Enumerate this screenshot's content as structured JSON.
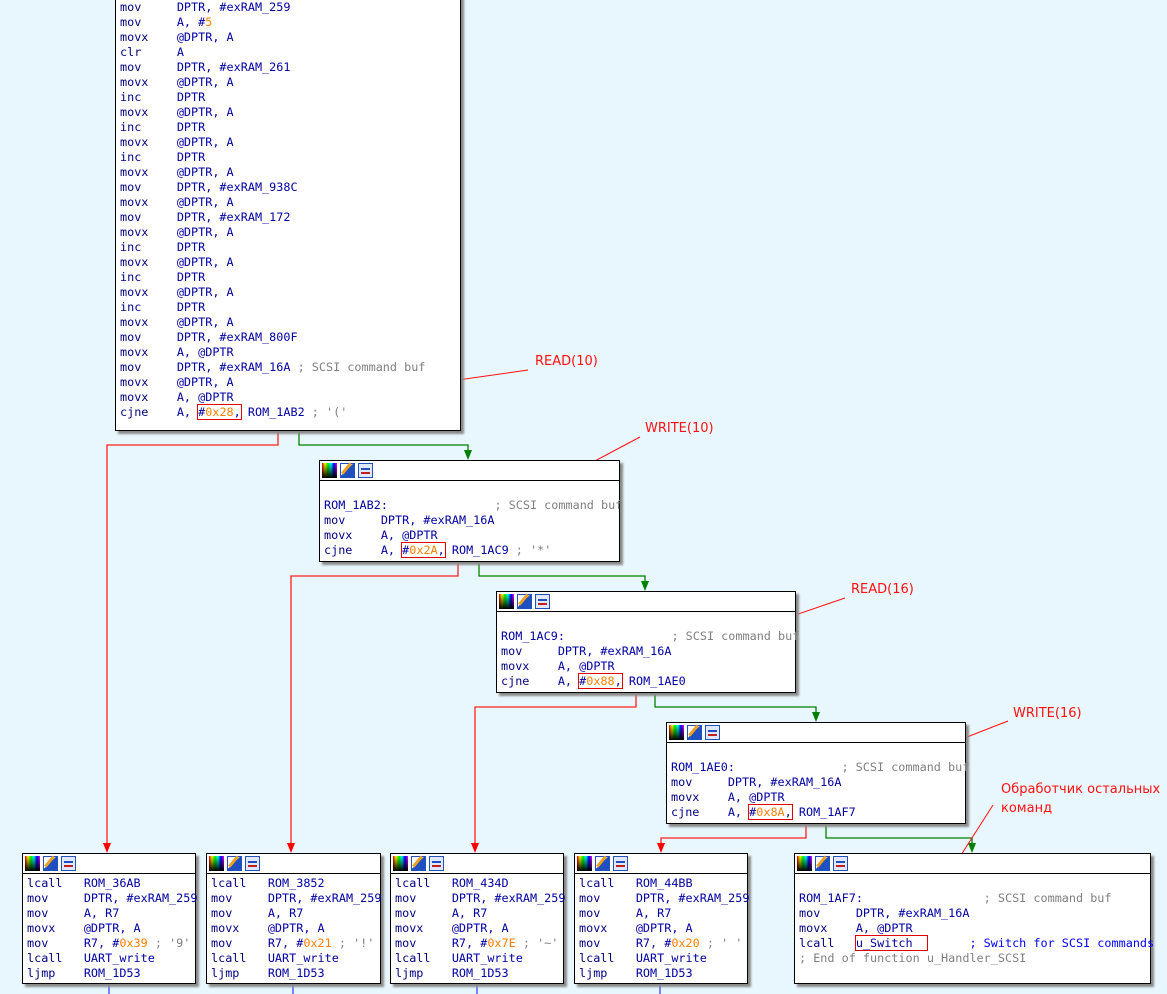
{
  "colors": {
    "background": "#e8f6fd",
    "true_edge": "#008000",
    "false_edge": "#ff0000",
    "flow_edge": "#4040ff",
    "annotation": "#ff1010",
    "number": "#ff8000"
  },
  "header_icons": [
    "color-palette-icon",
    "edit-pencil-icon",
    "graph-view-icon"
  ],
  "blocks": [
    {
      "id": "b0",
      "header": false,
      "lines": [
        {
          "mn": "mov",
          "seg": [
            {
              "t": "DPTR, #exRAM_259"
            }
          ]
        },
        {
          "mn": "mov",
          "seg": [
            {
              "t": "A, #"
            },
            {
              "t": "5",
              "c": "num"
            }
          ]
        },
        {
          "mn": "movx",
          "seg": [
            {
              "t": "@DPTR, A"
            }
          ]
        },
        {
          "mn": "clr",
          "seg": [
            {
              "t": "A"
            }
          ]
        },
        {
          "mn": "mov",
          "seg": [
            {
              "t": "DPTR, #exRAM_261"
            }
          ]
        },
        {
          "mn": "movx",
          "seg": [
            {
              "t": "@DPTR, A"
            }
          ]
        },
        {
          "mn": "inc",
          "seg": [
            {
              "t": "DPTR"
            }
          ]
        },
        {
          "mn": "movx",
          "seg": [
            {
              "t": "@DPTR, A"
            }
          ]
        },
        {
          "mn": "inc",
          "seg": [
            {
              "t": "DPTR"
            }
          ]
        },
        {
          "mn": "movx",
          "seg": [
            {
              "t": "@DPTR, A"
            }
          ]
        },
        {
          "mn": "inc",
          "seg": [
            {
              "t": "DPTR"
            }
          ]
        },
        {
          "mn": "movx",
          "seg": [
            {
              "t": "@DPTR, A"
            }
          ]
        },
        {
          "mn": "mov",
          "seg": [
            {
              "t": "DPTR, #exRAM_938C"
            }
          ]
        },
        {
          "mn": "movx",
          "seg": [
            {
              "t": "@DPTR, A"
            }
          ]
        },
        {
          "mn": "mov",
          "seg": [
            {
              "t": "DPTR, #exRAM_172"
            }
          ]
        },
        {
          "mn": "movx",
          "seg": [
            {
              "t": "@DPTR, A"
            }
          ]
        },
        {
          "mn": "inc",
          "seg": [
            {
              "t": "DPTR"
            }
          ]
        },
        {
          "mn": "movx",
          "seg": [
            {
              "t": "@DPTR, A"
            }
          ]
        },
        {
          "mn": "inc",
          "seg": [
            {
              "t": "DPTR"
            }
          ]
        },
        {
          "mn": "movx",
          "seg": [
            {
              "t": "@DPTR, A"
            }
          ]
        },
        {
          "mn": "inc",
          "seg": [
            {
              "t": "DPTR"
            }
          ]
        },
        {
          "mn": "movx",
          "seg": [
            {
              "t": "@DPTR, A"
            }
          ]
        },
        {
          "mn": "mov",
          "seg": [
            {
              "t": "DPTR, #exRAM_800F"
            }
          ]
        },
        {
          "mn": "movx",
          "seg": [
            {
              "t": "A, @DPTR"
            }
          ]
        },
        {
          "mn": "mov",
          "seg": [
            {
              "t": "DPTR, #exRAM_16A "
            },
            {
              "t": "; SCSI command buf",
              "c": "cmt"
            }
          ]
        },
        {
          "mn": "movx",
          "seg": [
            {
              "t": "@DPTR, A"
            }
          ]
        },
        {
          "mn": "movx",
          "seg": [
            {
              "t": "A, @DPTR"
            }
          ]
        },
        {
          "mn": "cjne",
          "seg": [
            {
              "t": "A, "
            },
            {
              "t": "#",
              "box": 1
            },
            {
              "t": "0x28",
              "c": "num",
              "box": 1
            },
            {
              "t": ",",
              "box": 1
            },
            {
              "t": " ROM_1AB2 "
            },
            {
              "t": "; '('",
              "c": "cmt"
            }
          ]
        }
      ]
    },
    {
      "id": "b1",
      "header": true,
      "lines": [
        {
          "seg": [
            {
              "t": " "
            }
          ]
        },
        {
          "seg": [
            {
              "t": "ROM_1AB2:               "
            },
            {
              "t": "; SCSI command buf",
              "c": "cmt"
            }
          ]
        },
        {
          "mn": "mov",
          "seg": [
            {
              "t": "DPTR, #exRAM_16A"
            }
          ]
        },
        {
          "mn": "movx",
          "seg": [
            {
              "t": "A, @DPTR"
            }
          ]
        },
        {
          "mn": "cjne",
          "seg": [
            {
              "t": "A, "
            },
            {
              "t": "#",
              "box": 1
            },
            {
              "t": "0x2A",
              "c": "num",
              "box": 1
            },
            {
              "t": ",",
              "box": 1
            },
            {
              "t": " ROM_1AC9 "
            },
            {
              "t": "; '*'",
              "c": "cmt"
            }
          ]
        }
      ]
    },
    {
      "id": "b2",
      "header": true,
      "lines": [
        {
          "seg": [
            {
              "t": " "
            }
          ]
        },
        {
          "seg": [
            {
              "t": "ROM_1AC9:               "
            },
            {
              "t": "; SCSI command buf",
              "c": "cmt"
            }
          ]
        },
        {
          "mn": "mov",
          "seg": [
            {
              "t": "DPTR, #exRAM_16A"
            }
          ]
        },
        {
          "mn": "movx",
          "seg": [
            {
              "t": "A, @DPTR"
            }
          ]
        },
        {
          "mn": "cjne",
          "seg": [
            {
              "t": "A, "
            },
            {
              "t": "#",
              "box": 1
            },
            {
              "t": "0x88",
              "c": "num",
              "box": 1
            },
            {
              "t": ",",
              "box": 1
            },
            {
              "t": " ROM_1AE0"
            }
          ]
        }
      ]
    },
    {
      "id": "b3",
      "header": true,
      "lines": [
        {
          "seg": [
            {
              "t": " "
            }
          ]
        },
        {
          "seg": [
            {
              "t": "ROM_1AE0:               "
            },
            {
              "t": "; SCSI command buf",
              "c": "cmt"
            }
          ]
        },
        {
          "mn": "mov",
          "seg": [
            {
              "t": "DPTR, #exRAM_16A"
            }
          ]
        },
        {
          "mn": "movx",
          "seg": [
            {
              "t": "A, @DPTR"
            }
          ]
        },
        {
          "mn": "cjne",
          "seg": [
            {
              "t": "A, "
            },
            {
              "t": "#",
              "box": 1
            },
            {
              "t": "0x8A",
              "c": "num",
              "box": 1
            },
            {
              "t": ",",
              "box": 1
            },
            {
              "t": " ROM_1AF7"
            }
          ]
        }
      ]
    },
    {
      "id": "b4",
      "header": true,
      "lines": [
        {
          "mn": "lcall",
          "seg": [
            {
              "t": "ROM_36AB"
            }
          ]
        },
        {
          "mn": "mov",
          "seg": [
            {
              "t": "DPTR, #exRAM_259"
            }
          ]
        },
        {
          "mn": "mov",
          "seg": [
            {
              "t": "A, R7"
            }
          ]
        },
        {
          "mn": "movx",
          "seg": [
            {
              "t": "@DPTR, A"
            }
          ]
        },
        {
          "mn": "mov",
          "seg": [
            {
              "t": "R7, #"
            },
            {
              "t": "0x39",
              "c": "num"
            },
            {
              "t": " "
            },
            {
              "t": "; '9'",
              "c": "cmt"
            }
          ]
        },
        {
          "mn": "lcall",
          "seg": [
            {
              "t": "UART_write"
            }
          ]
        },
        {
          "mn": "ljmp",
          "seg": [
            {
              "t": "ROM_1D53"
            }
          ]
        }
      ]
    },
    {
      "id": "b5",
      "header": true,
      "lines": [
        {
          "mn": "lcall",
          "seg": [
            {
              "t": "ROM_3852"
            }
          ]
        },
        {
          "mn": "mov",
          "seg": [
            {
              "t": "DPTR, #exRAM_259"
            }
          ]
        },
        {
          "mn": "mov",
          "seg": [
            {
              "t": "A, R7"
            }
          ]
        },
        {
          "mn": "movx",
          "seg": [
            {
              "t": "@DPTR, A"
            }
          ]
        },
        {
          "mn": "mov",
          "seg": [
            {
              "t": "R7, #"
            },
            {
              "t": "0x21",
              "c": "num"
            },
            {
              "t": " "
            },
            {
              "t": "; '!'",
              "c": "cmt"
            }
          ]
        },
        {
          "mn": "lcall",
          "seg": [
            {
              "t": "UART_write"
            }
          ]
        },
        {
          "mn": "ljmp",
          "seg": [
            {
              "t": "ROM_1D53"
            }
          ]
        }
      ]
    },
    {
      "id": "b6",
      "header": true,
      "lines": [
        {
          "mn": "lcall",
          "seg": [
            {
              "t": "ROM_434D"
            }
          ]
        },
        {
          "mn": "mov",
          "seg": [
            {
              "t": "DPTR, #exRAM_259"
            }
          ]
        },
        {
          "mn": "mov",
          "seg": [
            {
              "t": "A, R7"
            }
          ]
        },
        {
          "mn": "movx",
          "seg": [
            {
              "t": "@DPTR, A"
            }
          ]
        },
        {
          "mn": "mov",
          "seg": [
            {
              "t": "R7, #"
            },
            {
              "t": "0x7E",
              "c": "num"
            },
            {
              "t": " "
            },
            {
              "t": "; '~'",
              "c": "cmt"
            }
          ]
        },
        {
          "mn": "lcall",
          "seg": [
            {
              "t": "UART_write"
            }
          ]
        },
        {
          "mn": "ljmp",
          "seg": [
            {
              "t": "ROM_1D53"
            }
          ]
        }
      ]
    },
    {
      "id": "b7",
      "header": true,
      "lines": [
        {
          "mn": "lcall",
          "seg": [
            {
              "t": "ROM_44BB"
            }
          ]
        },
        {
          "mn": "mov",
          "seg": [
            {
              "t": "DPTR, #exRAM_259"
            }
          ]
        },
        {
          "mn": "mov",
          "seg": [
            {
              "t": "A, R7"
            }
          ]
        },
        {
          "mn": "movx",
          "seg": [
            {
              "t": "@DPTR, A"
            }
          ]
        },
        {
          "mn": "mov",
          "seg": [
            {
              "t": "R7, #"
            },
            {
              "t": "0x20",
              "c": "num"
            },
            {
              "t": " "
            },
            {
              "t": "; ' '",
              "c": "cmt"
            }
          ]
        },
        {
          "mn": "lcall",
          "seg": [
            {
              "t": "UART_write"
            }
          ]
        },
        {
          "mn": "ljmp",
          "seg": [
            {
              "t": "ROM_1D53"
            }
          ]
        }
      ]
    },
    {
      "id": "b8",
      "header": true,
      "lines": [
        {
          "seg": [
            {
              "t": " "
            }
          ]
        },
        {
          "seg": [
            {
              "t": "ROM_1AF7:                 "
            },
            {
              "t": "; SCSI command buf",
              "c": "cmt"
            }
          ]
        },
        {
          "mn": "mov",
          "seg": [
            {
              "t": "DPTR, #exRAM_16A"
            }
          ]
        },
        {
          "mn": "movx",
          "seg": [
            {
              "t": "A, @DPTR"
            }
          ]
        },
        {
          "mn": "lcall",
          "seg": [
            {
              "t": "u_Switch  ",
              "box": 1
            },
            {
              "t": "      "
            },
            {
              "t": "; Switch for SCSI commands",
              "c": "cmt2"
            }
          ]
        },
        {
          "seg": [
            {
              "t": "; End of function u_Handler_SCSI",
              "c": "cmt"
            }
          ]
        }
      ]
    }
  ],
  "annotations": [
    {
      "text": "READ(10)"
    },
    {
      "text": "WRITE(10)"
    },
    {
      "text": "READ(16)"
    },
    {
      "text": "WRITE(16)"
    },
    {
      "text": "Обработчик остальных\nкоманд"
    }
  ]
}
